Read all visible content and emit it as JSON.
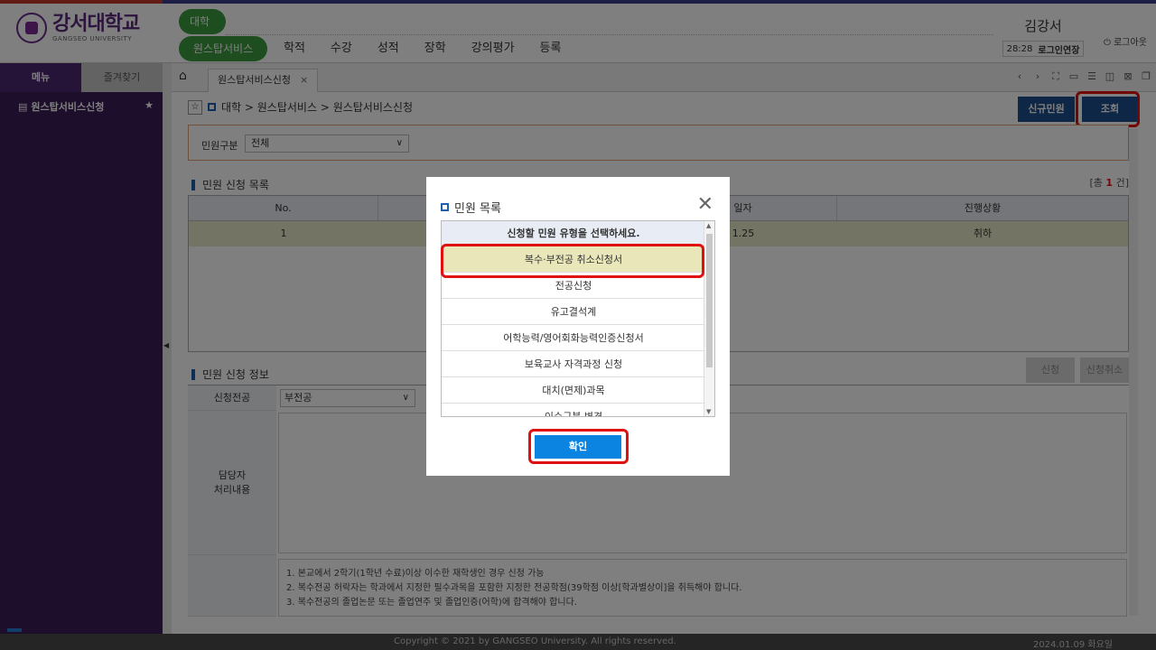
{
  "header": {
    "logo_kor": "강서대학교",
    "logo_eng": "GANGSEO UNIVERSITY",
    "pill_univ": "대학",
    "pill_service": "원스탑서비스",
    "nav": [
      "학적",
      "수강",
      "성적",
      "장학",
      "강의평가",
      "등록"
    ],
    "user_name": "김강서",
    "session_time": "28:28",
    "session_extend": "로그인연장",
    "logout": "로그아웃"
  },
  "sidebar": {
    "tab_menu": "메뉴",
    "tab_fav": "즐겨찾기",
    "item": "원스탑서비스신청"
  },
  "tabs": {
    "active": "원스탑서비스신청"
  },
  "breadcrumb": "대학 > 원스탑서비스 > 원스탑서비스신청",
  "buttons": {
    "new_request": "신규민원",
    "search": "조회",
    "apply": "신청",
    "cancel_apply": "신청취소"
  },
  "filter": {
    "label": "민원구분",
    "value": "전체"
  },
  "list_section": {
    "title": "민원 신청 목록",
    "count_prefix": "[총 ",
    "count": "1",
    "count_suffix": " 건]",
    "columns": [
      "No.",
      "",
      "일자",
      "진행상황"
    ],
    "row": {
      "no": "1",
      "date": "1.25",
      "status": "취하"
    }
  },
  "info_section": {
    "title": "민원 신청 정보",
    "major_label": "신청전공",
    "major_value": "부전공",
    "handler_label_1": "담당자",
    "handler_label_2": "처리내용",
    "notes": [
      "1. 본교에서 2학기(1학년 수료)이상 이수한 재학생인 경우 신청 가능",
      "2. 복수전공 허락자는 학과에서 지정한 필수과목을 포함한 지정한 전공학점(39학점 이상[학과별상이]을 취득해야 합니다.",
      "3. 복수전공의 졸업논문 또는 졸업연주 및 졸업인증(어학)에 합격해야 합니다."
    ]
  },
  "modal": {
    "title": "민원 목록",
    "close": "✕",
    "list_header": "신청할 민원 유형을 선택하세요.",
    "items": [
      "복수·부전공 취소신청서",
      "전공신청",
      "유고결석계",
      "어학능력/영어회화능력인증신청서",
      "보육교사 자격과정 신청",
      "대치(면제)과목",
      "이수구분 변경"
    ],
    "selected_index": 0,
    "confirm": "확인"
  },
  "footer": {
    "copyright": "Copyright © 2021 by GANGSEO University. All rights reserved.",
    "date": "2024.01.09 화요일"
  },
  "colors": {
    "brand_purple": "#3a1c57",
    "green": "#3d9b3f",
    "navy_button": "#1f4e8c",
    "confirm_blue": "#0a84e0",
    "highlight_red": "#e01010",
    "selected_row": "#e9e7b9"
  }
}
